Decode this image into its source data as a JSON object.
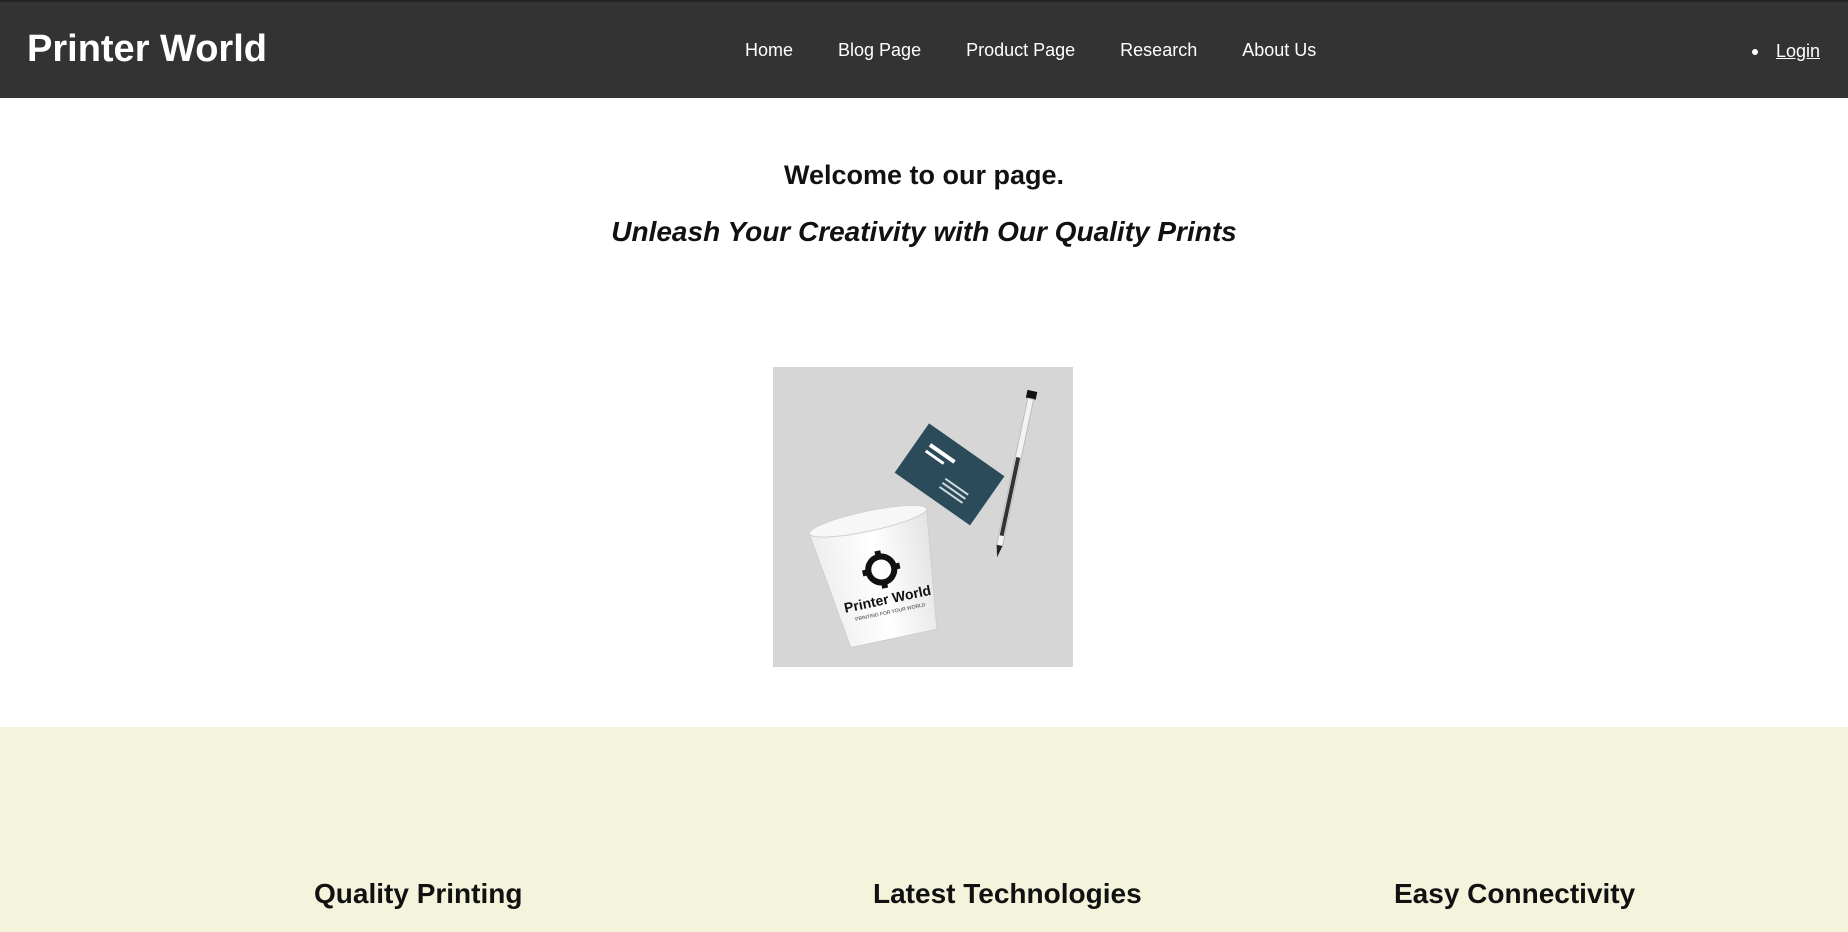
{
  "header": {
    "brand": "Printer World",
    "nav": [
      {
        "label": "Home"
      },
      {
        "label": "Blog Page"
      },
      {
        "label": "Product Page"
      },
      {
        "label": "Research"
      },
      {
        "label": "About Us"
      }
    ],
    "login": "Login"
  },
  "hero": {
    "title": "Welcome to our page.",
    "subtitle": "Unleash Your Creativity with Our Quality Prints",
    "image": {
      "cup_text": "Printer World",
      "cup_tagline": "PRINTING FOR YOUR WORLD"
    }
  },
  "features": [
    {
      "title": "Quality Printing"
    },
    {
      "title": "Latest Technologies"
    },
    {
      "title": "Easy Connectivity"
    }
  ],
  "colors": {
    "header_bg": "#333333",
    "features_bg": "#f4f4dc",
    "card_blue": "#2b4a5a"
  }
}
